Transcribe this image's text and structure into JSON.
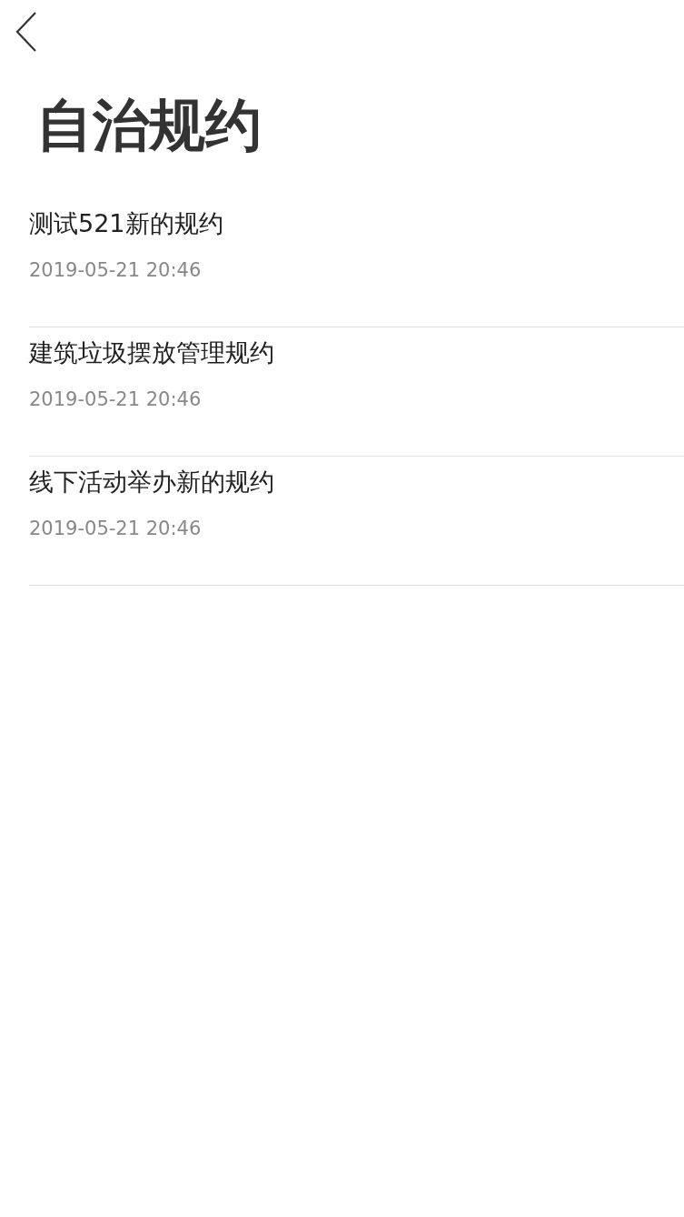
{
  "header": {
    "title": "自治规约"
  },
  "items": [
    {
      "title": "测试521新的规约",
      "date": "2019-05-21 20:46"
    },
    {
      "title": "建筑垃圾摆放管理规约",
      "date": "2019-05-21 20:46"
    },
    {
      "title": "线下活动举办新的规约",
      "date": "2019-05-21 20:46"
    }
  ]
}
